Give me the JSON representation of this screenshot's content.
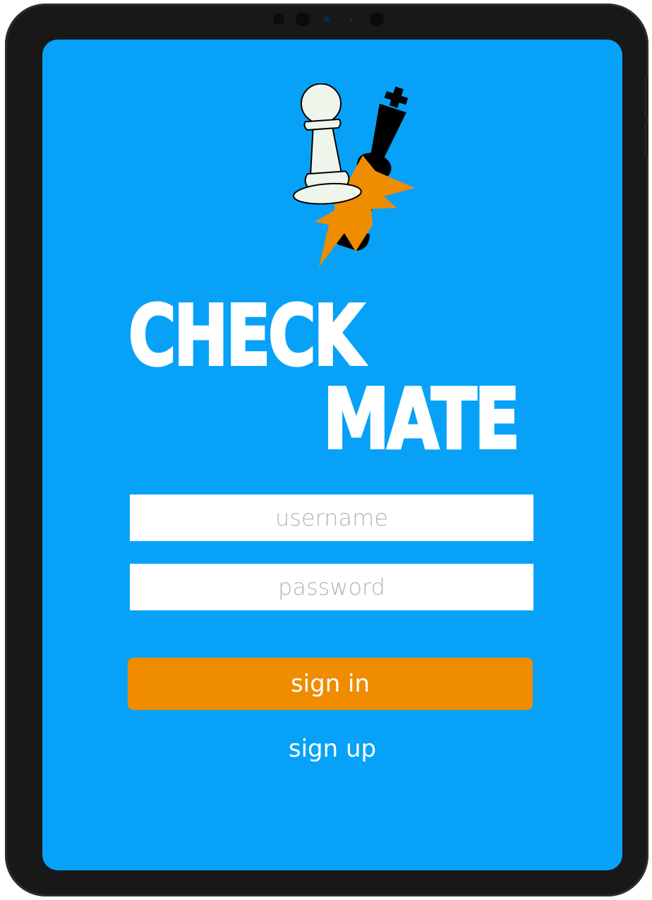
{
  "app": {
    "title_line1": "CHECK",
    "title_line2": "MATE"
  },
  "login": {
    "username_placeholder": "username",
    "password_placeholder": "password",
    "sign_in_label": "sign in",
    "sign_up_label": "sign up"
  },
  "logo": {
    "icons": [
      "white-pawn-icon",
      "black-king-icon",
      "orange-burst-icon"
    ]
  },
  "colors": {
    "screen_background": "#07a2f7",
    "accent_orange": "#ef8c00",
    "device_frame": "#181818",
    "text_white": "#ffffff",
    "placeholder_gray": "#b4b4b4"
  }
}
